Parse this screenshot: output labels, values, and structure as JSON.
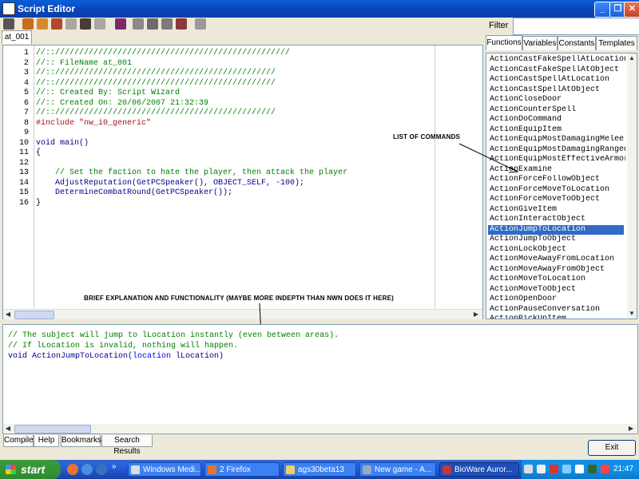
{
  "window": {
    "title": "Script Editor"
  },
  "doc_tab": "at_001",
  "editor": {
    "lines": [
      {
        "n": "1",
        "text": "//:://///////////////////////////////////////////////",
        "cls": "c-green"
      },
      {
        "n": "2",
        "text": "//:: FileName at_001",
        "cls": "c-green"
      },
      {
        "n": "3",
        "text": "//:://////////////////////////////////////////////",
        "cls": "c-green"
      },
      {
        "n": "4",
        "text": "//:://////////////////////////////////////////////",
        "cls": "c-green"
      },
      {
        "n": "5",
        "text": "//:: Created By: Script Wizard",
        "cls": "c-green"
      },
      {
        "n": "6",
        "text": "//:: Created On: 20/06/2007 21:32:39",
        "cls": "c-green"
      },
      {
        "n": "7",
        "text": "//:://////////////////////////////////////////////",
        "cls": "c-green"
      },
      {
        "n": "8",
        "text": "#include \"nw_i0_generic\"",
        "cls": "c-red"
      },
      {
        "n": "9",
        "text": "",
        "cls": ""
      },
      {
        "n": "10",
        "text": "void main()",
        "cls": "c-blue"
      },
      {
        "n": "11",
        "text": "{",
        "cls": ""
      },
      {
        "n": "12",
        "text": "",
        "cls": ""
      },
      {
        "n": "13",
        "text": "    // Set the faction to hate the player, then attack the player",
        "cls": "c-green"
      },
      {
        "n": "14",
        "text": "    AdjustReputation(GetPCSpeaker(), OBJECT_SELF, -100);",
        "cls": "c-blue"
      },
      {
        "n": "15",
        "text": "    DetermineCombatRound(GetPCSpeaker());",
        "cls": "c-blue"
      },
      {
        "n": "16",
        "text": "}",
        "cls": ""
      }
    ]
  },
  "filter": {
    "label": "Filter",
    "value": ""
  },
  "right_tabs": [
    "Functions",
    "Variables",
    "Constants",
    "Templates"
  ],
  "functions": [
    "ActionCastFakeSpellAtLocation",
    "ActionCastFakeSpellAtObject",
    "ActionCastSpellAtLocation",
    "ActionCastSpellAtObject",
    "ActionCloseDoor",
    "ActionCounterSpell",
    "ActionDoCommand",
    "ActionEquipItem",
    "ActionEquipMostDamagingMelee",
    "ActionEquipMostDamagingRanged",
    "ActionEquipMostEffectiveArmor",
    "ActionExamine",
    "ActionForceFollowObject",
    "ActionForceMoveToLocation",
    "ActionForceMoveToObject",
    "ActionGiveItem",
    "ActionInteractObject",
    "ActionJumpToLocation",
    "ActionJumpToObject",
    "ActionLockObject",
    "ActionMoveAwayFromLocation",
    "ActionMoveAwayFromObject",
    "ActionMoveToLocation",
    "ActionMoveToObject",
    "ActionOpenDoor",
    "ActionPauseConversation",
    "ActionPickUpItem"
  ],
  "selected_function": "ActionJumpToLocation",
  "annotations": {
    "commands": "LIST OF COMMANDS",
    "explanation": "BRIEF EXPLANATION AND FUNCTIONALITY (MAYBE MORE INDEPTH THAN NWN DOES IT HERE)"
  },
  "help": {
    "line1": "// The subject will jump to lLocation instantly (even between areas).",
    "line2": "// If lLocation is invalid, nothing will happen.",
    "sig_prefix": "void ActionJumpToLocation(",
    "sig_type": "location",
    "sig_suffix": " lLocation)"
  },
  "bottom_tabs": [
    "Compiler",
    "Help",
    "Bookmarks",
    "Search Results"
  ],
  "exit_label": "Exit",
  "taskbar": {
    "start": "start",
    "tasks": [
      "Windows Medi...",
      "2 Firefox",
      "ags30beta13",
      "New game - A...",
      "BioWare Auror..."
    ],
    "clock": "21:47"
  }
}
